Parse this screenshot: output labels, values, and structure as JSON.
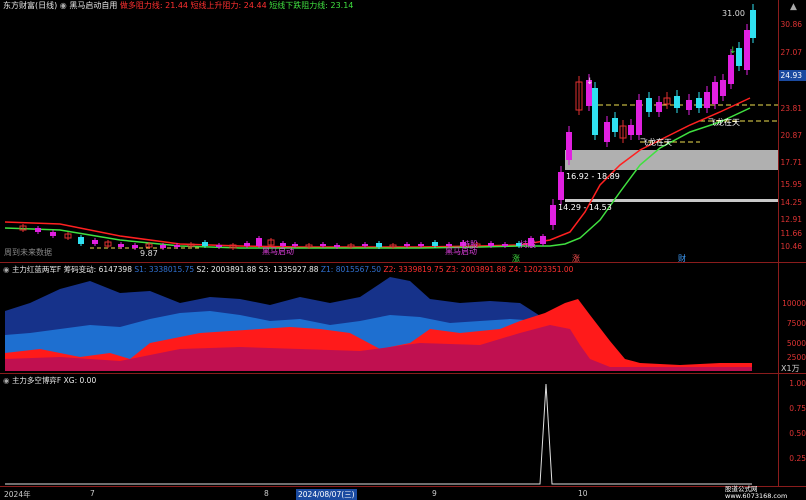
{
  "panel1": {
    "title": "东方财富(日线)",
    "indicator": "黑马启动自用",
    "line_a_label": "做多阻力线: 21.44",
    "line_b_label": "短线上升阻力: 24.44",
    "line_c_label": "短线下跌阻力线: 23.14",
    "top_price": "31.00",
    "current_price": "24.93",
    "box1_label": "16.92 - 18.89",
    "box2_label": "14.29 - 14.53",
    "low_label": "9.87",
    "sig_1": "飞龙在天",
    "sig_2": "飞龙在天",
    "sig_3": "黑马启动",
    "sig_4": "黑马启动",
    "sig_5": "持股",
    "sig_6": "持股",
    "mark_1": "涨",
    "mark_2": "涨",
    "mark_3": "财",
    "note": "周到未来数据",
    "y_ticks": [
      "30.86",
      "27.07",
      "24.93",
      "23.81",
      "20.87",
      "17.71",
      "15.95",
      "14.25",
      "12.91",
      "11.66",
      "10.46"
    ]
  },
  "panel2": {
    "title": "主力红蓝两军F",
    "sub": "筹码变动: 6147398",
    "s1": "S1: 3338015.75",
    "s2": "S2: 2003891.88",
    "s3": "S3: 1335927.88",
    "z1": "Z1: 8015567.50",
    "z2": "Z2: 3339819.75",
    "z3": "Z3: 2003891.88",
    "z4": "Z4: 12023351.00",
    "y_ticks": [
      "10000",
      "7500",
      "5000",
      "2500"
    ],
    "unit": "X1万"
  },
  "panel3": {
    "title": "主力多空博弈F",
    "xg": "XG: 0.00",
    "y_ticks": [
      "1.00",
      "0.75",
      "0.50",
      "0.25"
    ]
  },
  "xaxis": {
    "labels": [
      "2024年",
      "7",
      "8",
      "2024/08/07(三)",
      "9",
      "10"
    ]
  },
  "watermark": "股道公式网 www.6073168.com",
  "colors": {
    "up": "#e020e0",
    "up_hollow": "#e03030",
    "down": "#30e0f0",
    "red": "#ff1a1a",
    "blue": "#1e6fd0",
    "navy": "#16328a"
  }
}
